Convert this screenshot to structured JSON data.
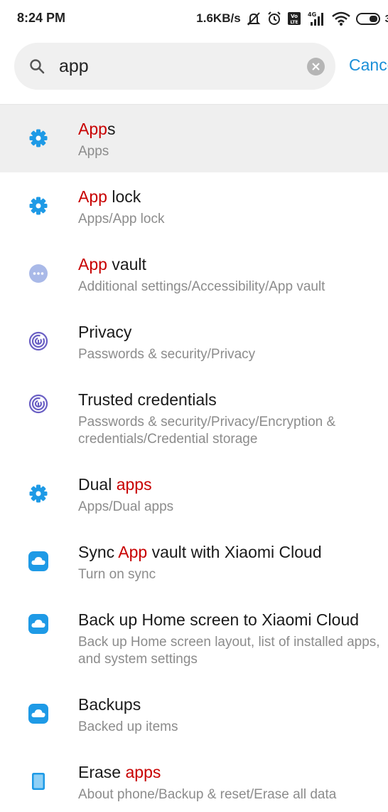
{
  "status_bar": {
    "time": "8:24 PM",
    "speed": "1.6KB/s",
    "battery_pct": "3",
    "icons": [
      "mute-alert-icon",
      "alarm-icon",
      "volte-icon",
      "signal-4g-icon",
      "wifi-icon",
      "battery-icon"
    ]
  },
  "search": {
    "query": "app",
    "cancel_label": "Cancel"
  },
  "results": [
    {
      "pre": "",
      "hl": "App",
      "post": "s",
      "subtitle": "Apps",
      "icon": "gear-icon"
    },
    {
      "pre": "",
      "hl": "App",
      "post": " lock",
      "subtitle": "Apps/App lock",
      "icon": "gear-icon"
    },
    {
      "pre": "",
      "hl": "App",
      "post": " vault",
      "subtitle": "Additional settings/Accessibility/App vault",
      "icon": "more-dots-icon"
    },
    {
      "pre": "Privacy",
      "hl": "",
      "post": "",
      "subtitle": "Passwords & security/Privacy",
      "icon": "fingerprint-icon"
    },
    {
      "pre": "Trusted credentials",
      "hl": "",
      "post": "",
      "subtitle": "Passwords & security/Privacy/Encryption & credentials/Credential storage",
      "icon": "fingerprint-icon"
    },
    {
      "pre": "Dual ",
      "hl": "apps",
      "post": "",
      "subtitle": "Apps/Dual apps",
      "icon": "gear-icon"
    },
    {
      "pre": "Sync ",
      "hl": "App",
      "post": " vault with Xiaomi Cloud",
      "subtitle": "Turn on sync",
      "icon": "cloud-icon"
    },
    {
      "pre": "Back up Home screen to Xiaomi Cloud",
      "hl": "",
      "post": "",
      "subtitle": "Back up Home screen layout, list of installed apps, and system settings",
      "icon": "cloud-icon"
    },
    {
      "pre": "Backups",
      "hl": "",
      "post": "",
      "subtitle": "Backed up items",
      "icon": "cloud-icon"
    },
    {
      "pre": "Erase ",
      "hl": "apps",
      "post": "",
      "subtitle": "About phone/Backup & reset/Erase all data",
      "icon": "phone-icon"
    }
  ],
  "colors": {
    "highlight": "#c80000",
    "accent": "#1a8fd8",
    "subtitle": "#8c8c8c",
    "gear": "#1e9ae6",
    "fingerprint": "#6a5fc4",
    "dots": "#a9b9e8"
  }
}
